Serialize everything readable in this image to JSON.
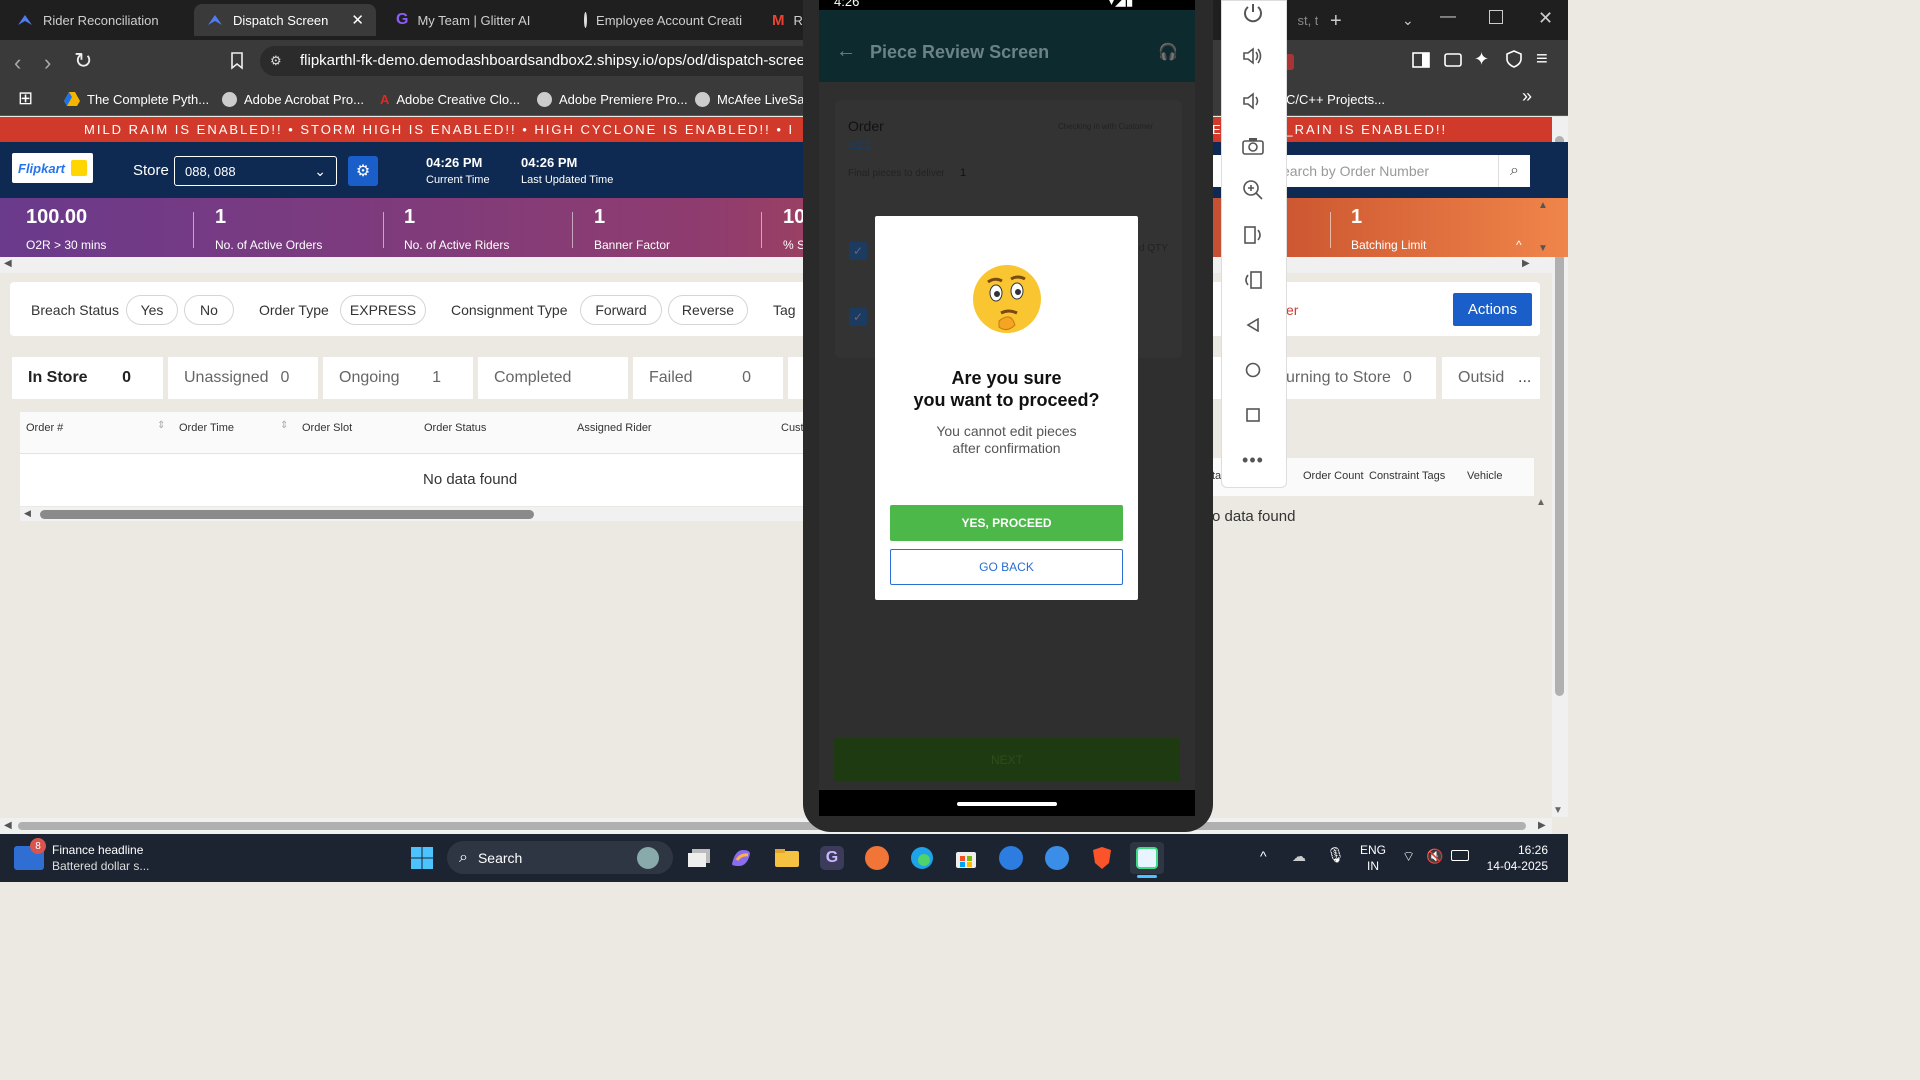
{
  "browser": {
    "tabs": [
      {
        "title": "Rider Reconciliation",
        "active": false
      },
      {
        "title": "Dispatch Screen",
        "active": true
      },
      {
        "title": "My Team | Glitter AI",
        "active": false
      },
      {
        "title": "Employee Account Creati",
        "active": false
      },
      {
        "title": "M",
        "active": false
      },
      {
        "title": "R",
        "active": false
      }
    ],
    "right_tab_fragment": "he",
    "right_tab_fragment2": "st, tı",
    "url": "flipkarthl-fk-demo.demodashboardsandbox2.shipsy.io/ops/od/dispatch-screen",
    "bookmarks": [
      "The Complete Pyth...",
      "Adobe Acrobat Pro...",
      "Adobe Creative Clo...",
      "Adobe Premiere Pro...",
      "McAfee LiveSafe"
    ],
    "bookmark_right": "C/C++ Projects..."
  },
  "ticker": {
    "left_text": "MILD RAIM IS ENABLED!! • STORM HIGH IS ENABLED!! • HIGH CYCLONE IS ENABLED!! • I",
    "right_text_prefix": "EI",
    "right_text": "AVY_RAIN IS ENABLED!!"
  },
  "header": {
    "logo": "Flipkart",
    "store_label": "Store",
    "store_value": "088, 088",
    "current_time": "04:26 PM",
    "current_time_label": "Current Time",
    "updated_time": "04:26 PM",
    "updated_time_label": "Last Updated Time",
    "search_placeholder": "earch by Order Number"
  },
  "metrics": [
    {
      "value": "100.00",
      "label": "O2R > 30 mins"
    },
    {
      "value": "1",
      "label": "No. of Active Orders"
    },
    {
      "value": "1",
      "label": "No. of Active Riders"
    },
    {
      "value": "1",
      "label": "Banner Factor"
    },
    {
      "value": "10",
      "label": "% S"
    },
    {
      "value": "1",
      "label": "Batching Limit"
    }
  ],
  "filters": {
    "breach_label": "Breach Status",
    "breach_options": [
      "Yes",
      "No"
    ],
    "order_type_label": "Order Type",
    "order_type_options": [
      "EXPRESS"
    ],
    "consignment_label": "Consignment Type",
    "consignment_options": [
      "Forward",
      "Reverse"
    ],
    "tag_label": "Tag",
    "right_fragment": "er",
    "actions": "Actions"
  },
  "status_tabs": [
    {
      "label": "In Store",
      "count": "0"
    },
    {
      "label": "Unassigned",
      "count": "0"
    },
    {
      "label": "Ongoing",
      "count": "1"
    },
    {
      "label": "Completed",
      "count": ""
    },
    {
      "label": "Failed",
      "count": "0"
    }
  ],
  "status_tabs_right": {
    "label": "urning to Store",
    "count": "0",
    "extra": "Outsid",
    "more": "..."
  },
  "table": {
    "headers": [
      "Order #",
      "Order Time",
      "Order Slot",
      "Order Status",
      "Assigned Rider",
      "Cust"
    ],
    "right_headers": [
      "ta",
      "Order Count",
      "Constraint Tags",
      "Vehicle"
    ],
    "empty": "No data found",
    "right_empty": "o data found"
  },
  "phone": {
    "status_time": "4:26",
    "title": "Piece Review Screen",
    "order_label": "Order",
    "order_id": "a21",
    "checkin_text": "Checking in with Customer",
    "final_pieces_label": "Final pieces to deliver",
    "final_pieces_value": "1",
    "qty_fragment": "d QTY",
    "next_button": "NEXT",
    "dialog": {
      "emoji": "🤔",
      "title_line1": "Are you sure",
      "title_line2": "you want to proceed?",
      "subtitle_line1": "You cannot edit pieces",
      "subtitle_line2": "after confirmation",
      "yes_button": "YES, PROCEED",
      "back_button": "GO BACK"
    }
  },
  "taskbar": {
    "news_badge": "8",
    "news_title": "Finance headline",
    "news_sub": "Battered dollar s...",
    "search": "Search",
    "lang_1": "ENG",
    "lang_2": "IN",
    "time": "16:26",
    "date": "14-04-2025"
  },
  "colors": {
    "brand_navy": "#0e2a52",
    "ticker_red": "#d13a2b",
    "action_blue": "#1a5fc9",
    "proceed_green": "#4cb84a",
    "back_blue": "#2a6fd1"
  }
}
